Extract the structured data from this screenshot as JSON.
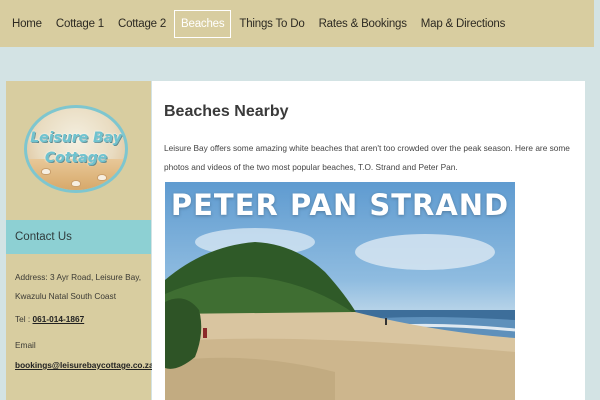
{
  "nav": {
    "items": [
      {
        "label": "Home",
        "active": false
      },
      {
        "label": "Cottage 1",
        "active": false
      },
      {
        "label": "Cottage 2",
        "active": false
      },
      {
        "label": "Beaches",
        "active": true
      },
      {
        "label": "Things To Do",
        "active": false
      },
      {
        "label": "Rates & Bookings",
        "active": false
      },
      {
        "label": "Map & Directions",
        "active": false
      }
    ]
  },
  "sidebar": {
    "logo": {
      "line1": "Leisure Bay",
      "line2": "Cottage"
    },
    "contact_heading": "Contact Us",
    "address_line1": "Address: 3 Ayr Road, Leisure Bay,",
    "address_line2": "Kwazulu Natal South Coast",
    "tel_label": "Tel : ",
    "tel_value": "061-014-1867",
    "email_label": "Email",
    "email_value": "bookings@leisurebaycottage.co.za"
  },
  "main": {
    "title": "Beaches Nearby",
    "intro": "Leisure Bay offers some amazing white beaches that aren't too crowded over the peak season. Here are some photos and videos of the two most popular beaches, T.O. Strand and Peter Pan.",
    "photo_caption": "PETER PAN STRAND"
  },
  "colors": {
    "page_bg": "#d3e3e4",
    "nav_bg": "#d8cda0",
    "sidebar_bg": "#d8cda0",
    "contact_head_bg": "#8dd0d3"
  }
}
